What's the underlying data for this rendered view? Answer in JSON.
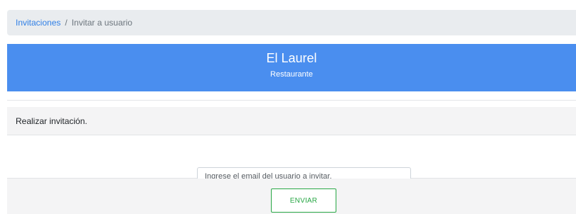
{
  "breadcrumb": {
    "link_label": "Invitaciones",
    "separator": "/",
    "current_label": "Invitar a usuario"
  },
  "banner": {
    "title": "El Laurel",
    "subtitle": "Restaurante",
    "background_color": "#4a8eef"
  },
  "invite_card": {
    "header": "Realizar invitación.",
    "email_input": {
      "value": "",
      "placeholder": "Ingrese el email del usuario a invitar."
    },
    "send_button_label": "ENVIAR"
  }
}
